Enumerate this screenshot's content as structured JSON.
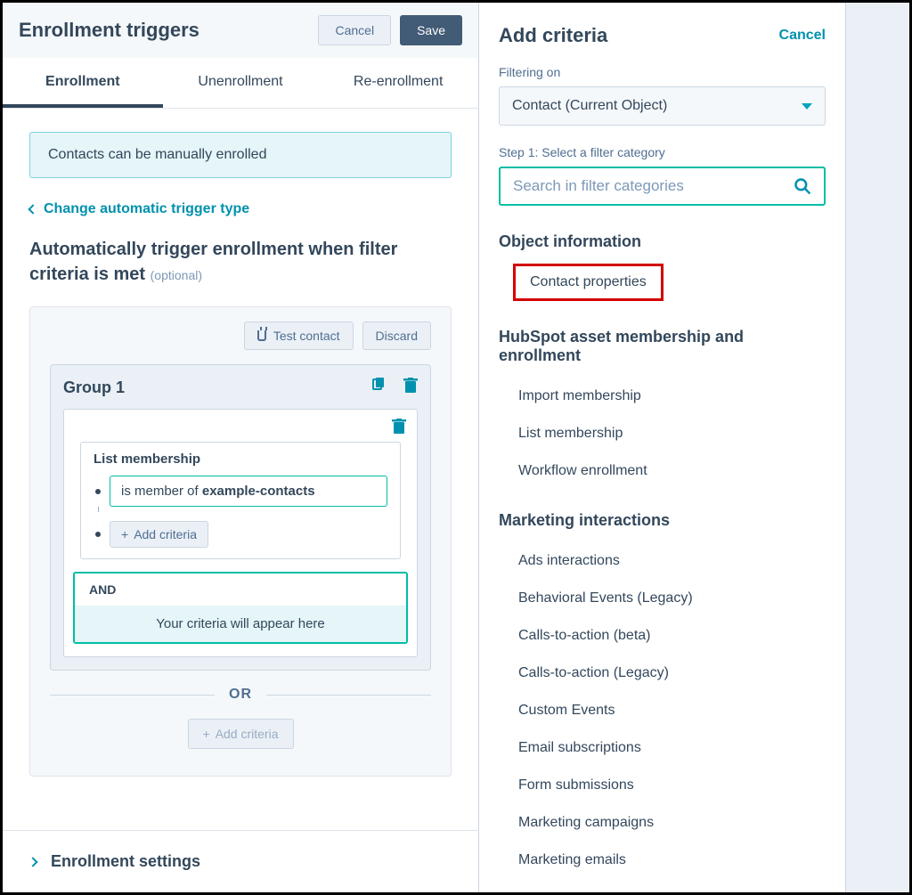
{
  "left": {
    "title": "Enrollment triggers",
    "cancel": "Cancel",
    "save": "Save",
    "tabs": {
      "enrollment": "Enrollment",
      "unenrollment": "Unenrollment",
      "reenrollment": "Re-enrollment"
    },
    "banner": "Contacts can be manually enrolled",
    "changeTriggerLink": "Change automatic trigger type",
    "autoHeading": "Automatically trigger enrollment when filter criteria is met",
    "optional": "(optional)",
    "testContact": "Test contact",
    "discard": "Discard",
    "group1": "Group 1",
    "listMembership": "List membership",
    "isMemberOf": "is member of ",
    "exampleContacts": "example-contacts",
    "addCriteria": "Add criteria",
    "and": "AND",
    "criteriaAppear": "Your criteria will appear here",
    "or": "OR",
    "addCriteriaBottom": "Add criteria",
    "enrollmentSettings": "Enrollment settings"
  },
  "right": {
    "title": "Add criteria",
    "cancel": "Cancel",
    "filteringOn": "Filtering on",
    "filterObject": "Contact (Current Object)",
    "step1": "Step 1: Select a filter category",
    "searchPlaceholder": "Search in filter categories",
    "sections": {
      "objectInfo": "Object information",
      "contactProperties": "Contact properties",
      "assetMembership": "HubSpot asset membership and enrollment",
      "importMembership": "Import membership",
      "listMembership": "List membership",
      "workflowEnrollment": "Workflow enrollment",
      "marketingInteractions": "Marketing interactions",
      "adsInteractions": "Ads interactions",
      "behavioralEvents": "Behavioral Events (Legacy)",
      "ctaBeta": "Calls-to-action (beta)",
      "ctaLegacy": "Calls-to-action (Legacy)",
      "customEvents": "Custom Events",
      "emailSubscriptions": "Email subscriptions",
      "formSubmissions": "Form submissions",
      "marketingCampaigns": "Marketing campaigns",
      "marketingEmails": "Marketing emails"
    }
  }
}
